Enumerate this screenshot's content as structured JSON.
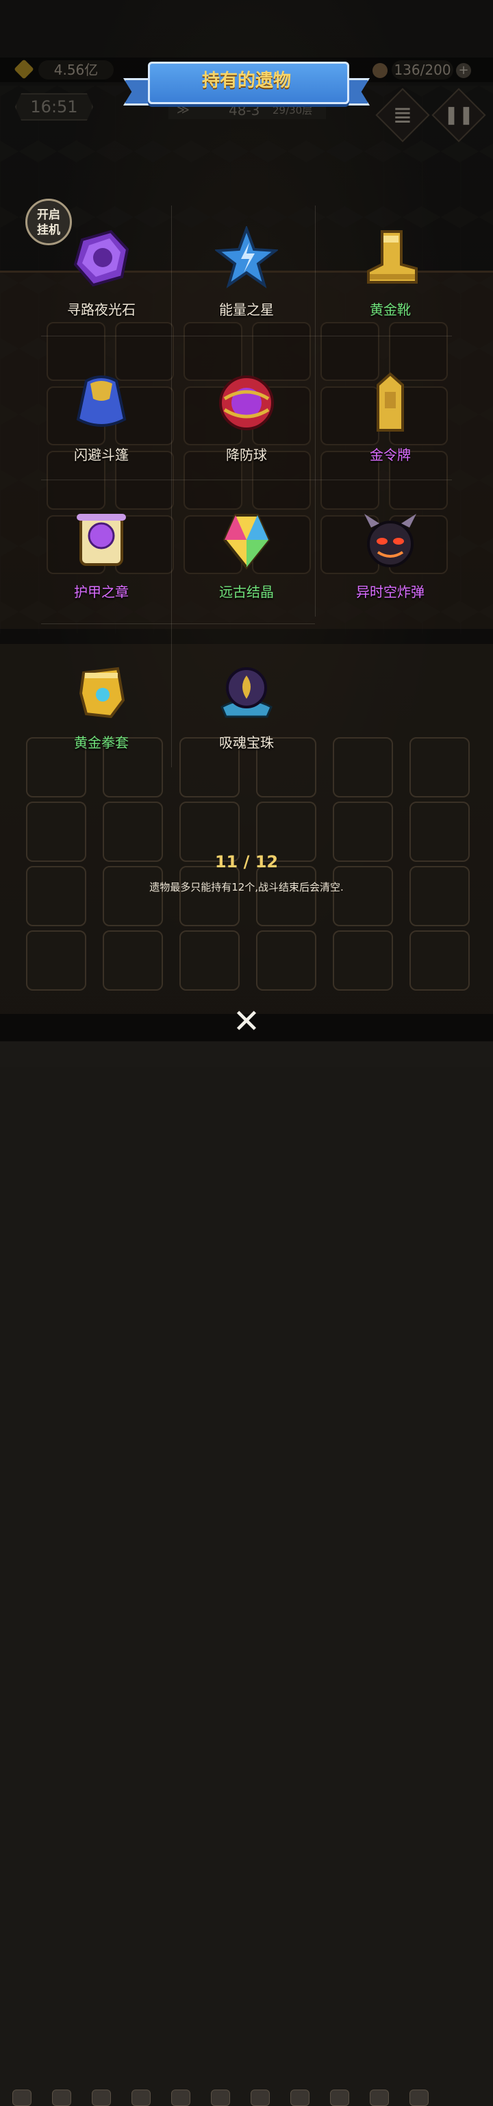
{
  "hud": {
    "gold_amount": "4.56亿",
    "stamina": "136/200",
    "stamina_plus": "+",
    "time": "16:51",
    "floor_code": "48-3",
    "floor_progress": "29/30层",
    "floor_chevron": "≫",
    "log_icon_glyph": "≣",
    "pause_icon_glyph": "❚❚",
    "hang_toggle": "开启\n挂机"
  },
  "modal": {
    "title": "持有的遗物",
    "count": "11 / 12",
    "notice": "遗物最多只能持有12个,战斗结束后会清空.",
    "close_glyph": "✕"
  },
  "relics": [
    {
      "name": "寻路夜光石",
      "color": "#efe6d6",
      "icon": "purple-stone-icon"
    },
    {
      "name": "能量之星",
      "color": "#efe6d6",
      "icon": "blue-star-icon"
    },
    {
      "name": "黄金靴",
      "color": "#6fe07a",
      "icon": "golden-boot-icon"
    },
    {
      "name": "闪避斗篷",
      "color": "#efe6d6",
      "icon": "blue-cloak-icon"
    },
    {
      "name": "降防球",
      "color": "#efe6d6",
      "icon": "red-orb-icon"
    },
    {
      "name": "金令牌",
      "color": "#d96cff",
      "icon": "gold-token-icon"
    },
    {
      "name": "护甲之章",
      "color": "#d96cff",
      "icon": "purple-scroll-icon"
    },
    {
      "name": "远古结晶",
      "color": "#6fe07a",
      "icon": "rainbow-crystal-icon"
    },
    {
      "name": "异时空炸弹",
      "color": "#d96cff",
      "icon": "demon-bomb-icon"
    },
    {
      "name": "黄金拳套",
      "color": "#6fe07a",
      "icon": "golden-gauntlet-icon"
    },
    {
      "name": "吸魂宝珠",
      "color": "#efe6d6",
      "icon": "soul-orb-icon"
    }
  ]
}
